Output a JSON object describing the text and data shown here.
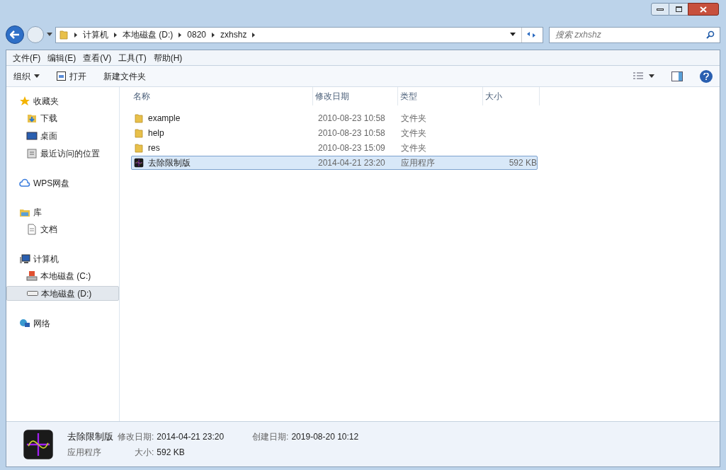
{
  "address": {
    "crumbs": [
      "计算机",
      "本地磁盘 (D:)",
      "0820",
      "zxhshz"
    ]
  },
  "search": {
    "placeholder": "搜索 zxhshz"
  },
  "menu": [
    "文件(F)",
    "编辑(E)",
    "查看(V)",
    "工具(T)",
    "帮助(H)"
  ],
  "toolbar": [
    {
      "label": "组织",
      "kind": "dropdown"
    },
    {
      "label": "打开",
      "kind": "open"
    },
    {
      "label": "新建文件夹",
      "kind": "plain"
    }
  ],
  "sidebar": {
    "groups": [
      {
        "label": "收藏夹",
        "selected": false,
        "children": [
          {
            "label": "下载",
            "selected": false
          },
          {
            "label": "桌面",
            "selected": false
          },
          {
            "label": "最近访问的位置",
            "selected": false
          }
        ]
      },
      {
        "label": "WPS网盘",
        "selected": false
      },
      {
        "label": "库",
        "selected": false,
        "children": [
          {
            "label": "文档",
            "selected": false
          }
        ]
      },
      {
        "label": "计算机",
        "selected": false,
        "children": [
          {
            "label": "本地磁盘 (C:)",
            "selected": false
          },
          {
            "label": "本地磁盘 (D:)",
            "selected": true
          }
        ]
      },
      {
        "label": "网络",
        "selected": false
      }
    ]
  },
  "table": {
    "columns": [
      "名称",
      "修改日期",
      "类型",
      "大小"
    ],
    "rows": [
      {
        "kind": "folder",
        "name": "example",
        "date": "2010-08-23 10:58",
        "type": "文件夹",
        "selected": false
      },
      {
        "kind": "folder",
        "name": "help",
        "date": "2010-08-23 10:58",
        "type": "文件夹",
        "selected": false
      },
      {
        "kind": "folder",
        "name": "res",
        "date": "2010-08-23 15:09",
        "type": "文件夹",
        "selected": false
      },
      {
        "kind": "app",
        "name": "去除限制版",
        "date": "2014-04-21 23:20",
        "type": "应用程序",
        "size": "592 KB",
        "selected": true
      }
    ]
  },
  "details": {
    "name": "去除限制版",
    "type": "应用程序",
    "modified_label": "修改日期:",
    "modified": "2014-04-21 23:20",
    "size_label": "大小:",
    "size": "592 KB",
    "created_label": "创建日期:",
    "created": "2019-08-20 10:12"
  }
}
